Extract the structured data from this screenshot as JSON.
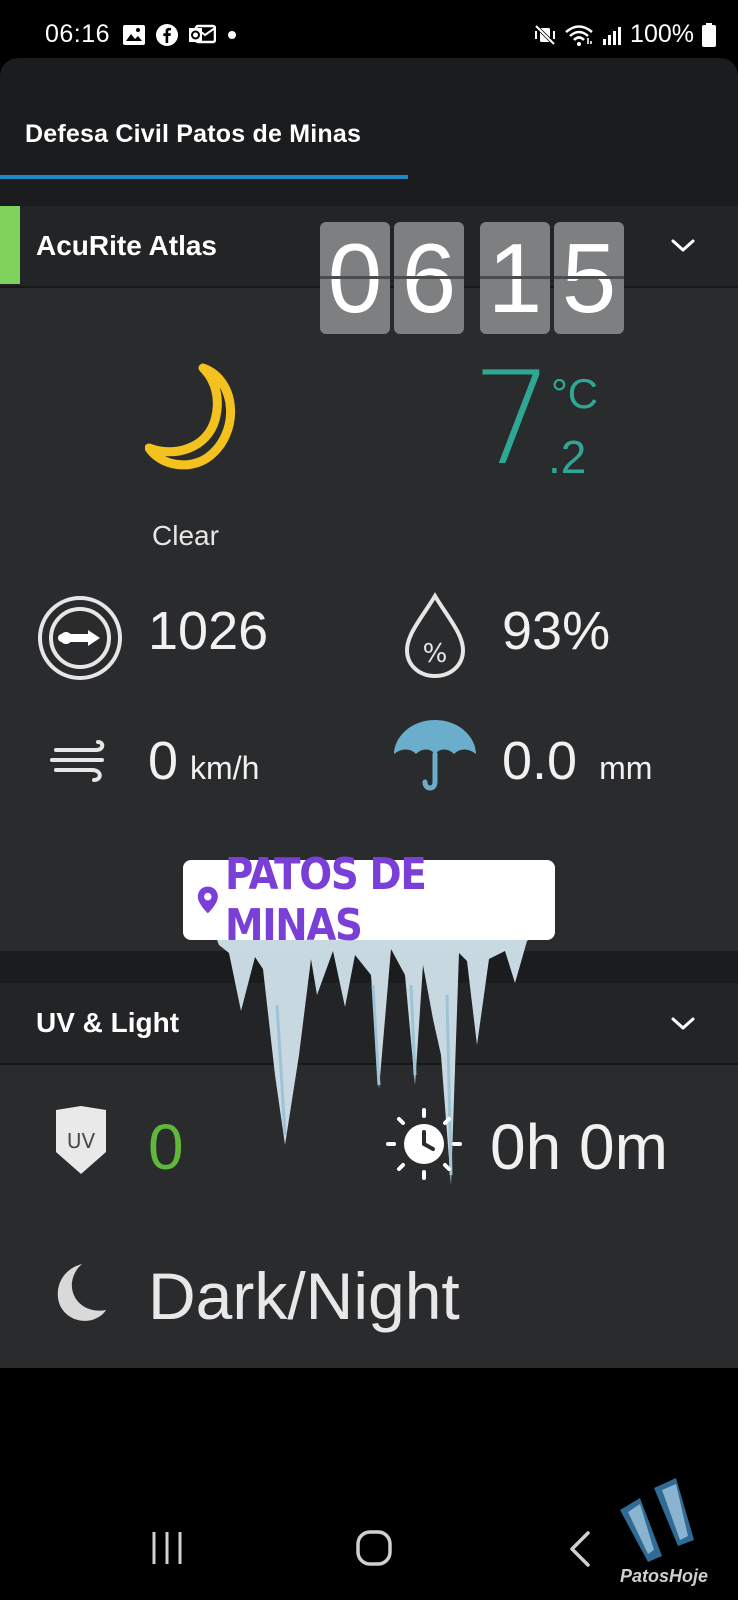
{
  "status_bar": {
    "time": "06:16",
    "battery": "100%"
  },
  "tab": {
    "label": "Defesa Civil Patos de Minas"
  },
  "station": {
    "name": "AcuRite Atlas",
    "clock_overlay": [
      "0",
      "6",
      "1",
      "5"
    ],
    "condition": "Clear",
    "temperature": {
      "whole": "7",
      "decimal": ".2",
      "unit": "°C"
    },
    "pressure": "1026",
    "humidity": "93%",
    "wind": {
      "value": "0",
      "unit": "km/h"
    },
    "rain": {
      "value": "0.0",
      "unit": "mm"
    }
  },
  "location_sticker": "PATOS DE MINAS",
  "uv_light": {
    "title": "UV & Light",
    "uv_badge": "UV",
    "uv_index": "0",
    "daylight": "0h 0m",
    "light_condition": "Dark/Night"
  },
  "watermark": "PatosHoje",
  "colors": {
    "accent_tab": "#1e88c8",
    "station_marker": "#7fd35c",
    "temperature": "#2fa795",
    "uv_value": "#5fb83a",
    "moon": "#f4c21f",
    "umbrella": "#6aaecc",
    "sticker_text": "#7a3fd6"
  },
  "icons": {
    "weather": "crescent-moon-icon",
    "pressure": "barometer-icon",
    "humidity": "humidity-drop-icon",
    "wind": "wind-icon",
    "rain": "umbrella-icon",
    "uv": "uv-shield-icon",
    "daylight": "sun-clock-icon",
    "light": "moon-icon"
  }
}
